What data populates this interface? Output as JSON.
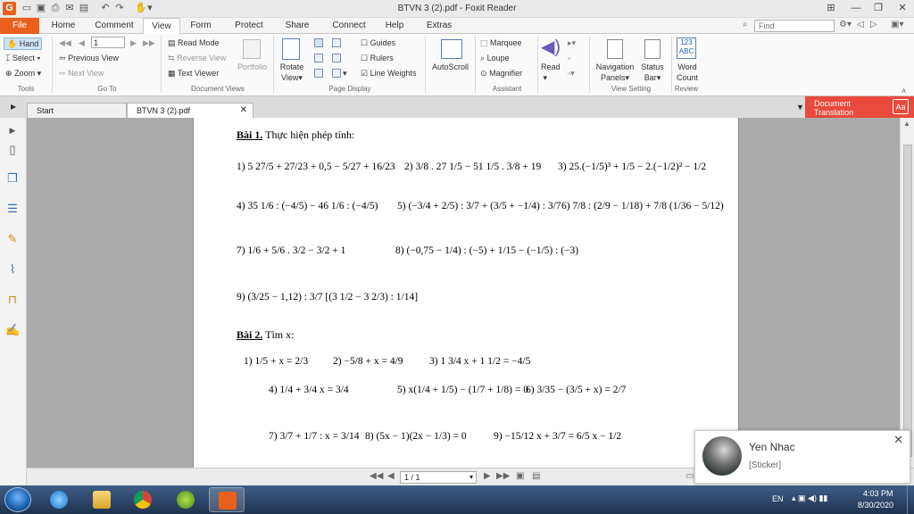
{
  "title_bar": {
    "title": "BTVN 3  (2).pdf - Foxit Reader"
  },
  "menu": {
    "file": "File",
    "home": "Home",
    "comment": "Comment",
    "view": "View",
    "form": "Form",
    "protect": "Protect",
    "share": "Share",
    "connect": "Connect",
    "help": "Help",
    "extras": "Extras"
  },
  "search": {
    "placeholder": "Find"
  },
  "ribbon": {
    "tools": {
      "hand": "Hand",
      "select": "Select",
      "zoom": "Zoom",
      "group": "Tools"
    },
    "goto": {
      "page_value": "1",
      "previous_view": "Previous View",
      "next_view": "Next View",
      "group": "Go To"
    },
    "document_views": {
      "read_mode": "Read Mode",
      "reverse_view": "Reverse View",
      "text_viewer": "Text Viewer",
      "portfolio": "Portfolio",
      "group": "Document Views"
    },
    "page_display": {
      "rotate_view": "Rotate",
      "rotate_view2": "View",
      "guides": "Guides",
      "rulers": "Rulers",
      "line_weights": "Line Weights",
      "group": "Page Display"
    },
    "autoscroll": "AutoScroll",
    "assistant": {
      "marquee": "Marquee",
      "loupe": "Loupe",
      "magnifier": "Magnifier",
      "group": "Assistant"
    },
    "read": "Read",
    "view_setting": {
      "navigation_panels": "Navigation",
      "navigation_panels2": "Panels",
      "status_bar": "Status",
      "status_bar2": "Bar",
      "group": "View Setting"
    },
    "review": {
      "word_count": "Word",
      "word_count2": "Count",
      "icon_text": "123\nABC",
      "group": "Review"
    }
  },
  "tabs": {
    "start": "Start",
    "doc": "BTVN 3  (2).pdf"
  },
  "doc_translation": {
    "line1": "Document",
    "line2": "Translation"
  },
  "document": {
    "bai1_title": "Bài 1.",
    "bai1_sub": "Thực hiện phép tính:",
    "bai1": [
      "1) 5 27/5 + 27/23 + 0,5 − 5/27 + 16/23",
      "2) 3/8 . 27 1/5 − 51 1/5 . 3/8 + 19",
      "3) 25.(−1/5)³ + 1/5 − 2.(−1/2)² − 1/2",
      "4) 35 1/6 : (−4/5) − 46 1/6 : (−4/5)",
      "5) (−3/4 + 2/5) : 3/7 + (3/5 + −1/4) : 3/7",
      "6) 7/8 : (2/9 − 1/18) + 7/8 (1/36 − 5/12)",
      "7) 1/6 + 5/6 . 3/2 − 3/2 + 1",
      "8) (−0,75 − 1/4) : (−5) + 1/15 − (−1/5) : (−3)",
      "9) (3/25 − 1,12) : 3/7 [(3 1/2 − 3 2/3) : 1/14]"
    ],
    "bai2_title": "Bài 2.",
    "bai2_sub": "Tìm x:",
    "bai2": [
      "1)  1/5 + x = 2/3",
      "2) −5/8 + x = 4/9",
      "3) 1 3/4 x + 1 1/2 = −4/5",
      "4) 1/4 + 3/4 x = 3/4",
      "5) x(1/4 + 1/5) − (1/7 + 1/8) = 0",
      "6) 3/35 − (3/5 + x) = 2/7",
      "7) 3/7 + 1/7 : x = 3/14",
      "8) (5x − 1)(2x − 1/3) = 0",
      "9) −15/12 x + 3/7 = 6/5 x − 1/2"
    ]
  },
  "status": {
    "page": "1 / 1"
  },
  "taskbar": {
    "lang": "EN",
    "time": "4:03 PM",
    "date": "8/30/2020"
  },
  "notification": {
    "name": "Yen Nhac",
    "message": "[Sticker]"
  }
}
